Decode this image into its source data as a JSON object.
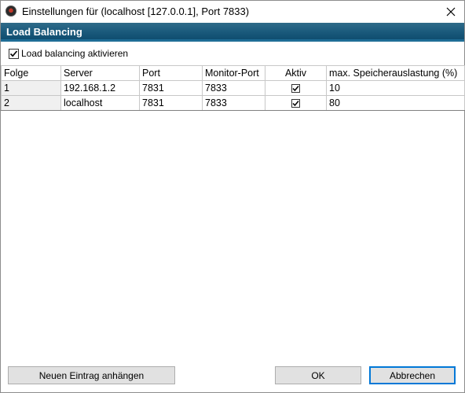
{
  "window": {
    "title": "Einstellungen für  (localhost [127.0.0.1], Port 7833)"
  },
  "section": {
    "title": "Load Balancing"
  },
  "enable_checkbox": {
    "label": "Load balancing aktivieren",
    "checked": true
  },
  "table": {
    "columns": [
      "Folge",
      "Server",
      "Port",
      "Monitor-Port",
      "Aktiv",
      "max. Speicherauslastung (%)"
    ],
    "rows": [
      {
        "order": "1",
        "server": "192.168.1.2",
        "port": "7831",
        "monitor_port": "7833",
        "active": true,
        "max_memory": "10"
      },
      {
        "order": "2",
        "server": "localhost",
        "port": "7831",
        "monitor_port": "7833",
        "active": true,
        "max_memory": "80"
      }
    ]
  },
  "buttons": {
    "add_entry": "Neuen Eintrag anhängen",
    "ok": "OK",
    "cancel": "Abbrechen"
  },
  "icons": {
    "app": "app-icon",
    "close": "close-icon",
    "check": "checkmark-icon"
  }
}
